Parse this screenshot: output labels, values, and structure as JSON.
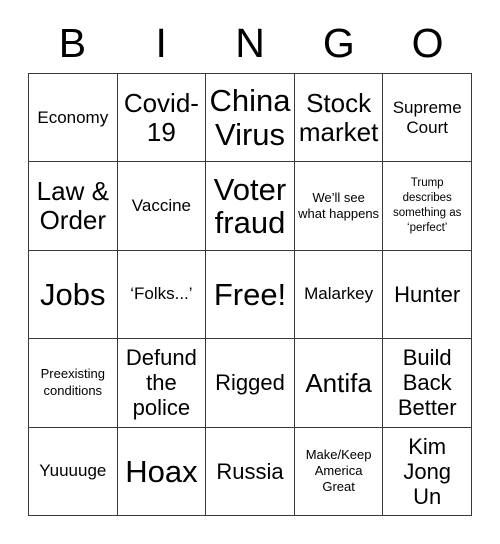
{
  "card": {
    "header_letters": [
      "B",
      "I",
      "N",
      "G",
      "O"
    ],
    "rows": [
      [
        {
          "text": "Economy",
          "size": "sm"
        },
        {
          "text": "Covid-19",
          "size": "lg"
        },
        {
          "text": "China Virus",
          "size": "xl"
        },
        {
          "text": "Stock market",
          "size": "lg"
        },
        {
          "text": "Supreme Court",
          "size": "sm"
        }
      ],
      [
        {
          "text": "Law & Order",
          "size": "lg"
        },
        {
          "text": "Vaccine",
          "size": "sm"
        },
        {
          "text": "Voter fraud",
          "size": "xl"
        },
        {
          "text": "We’ll see what happens",
          "size": "xs"
        },
        {
          "text": "Trump describes something as ‘perfect’",
          "size": "xxs"
        }
      ],
      [
        {
          "text": "Jobs",
          "size": "xl"
        },
        {
          "text": "‘Folks...’",
          "size": "sm"
        },
        {
          "text": "Free!",
          "size": "xl"
        },
        {
          "text": "Malarkey",
          "size": "sm"
        },
        {
          "text": "Hunter",
          "size": "md"
        }
      ],
      [
        {
          "text": "Preexisting conditions",
          "size": "xs"
        },
        {
          "text": "Defund the police",
          "size": "md"
        },
        {
          "text": "Rigged",
          "size": "md"
        },
        {
          "text": "Antifa",
          "size": "lg"
        },
        {
          "text": "Build Back Better",
          "size": "md"
        }
      ],
      [
        {
          "text": "Yuuuuge",
          "size": "sm"
        },
        {
          "text": "Hoax",
          "size": "xl"
        },
        {
          "text": "Russia",
          "size": "md"
        },
        {
          "text": "Make/Keep America Great",
          "size": "xs"
        },
        {
          "text": "Kim Jong Un",
          "size": "md"
        }
      ]
    ]
  },
  "colors": {
    "border": "#3a3a3a",
    "text": "#000000",
    "background": "#ffffff"
  }
}
